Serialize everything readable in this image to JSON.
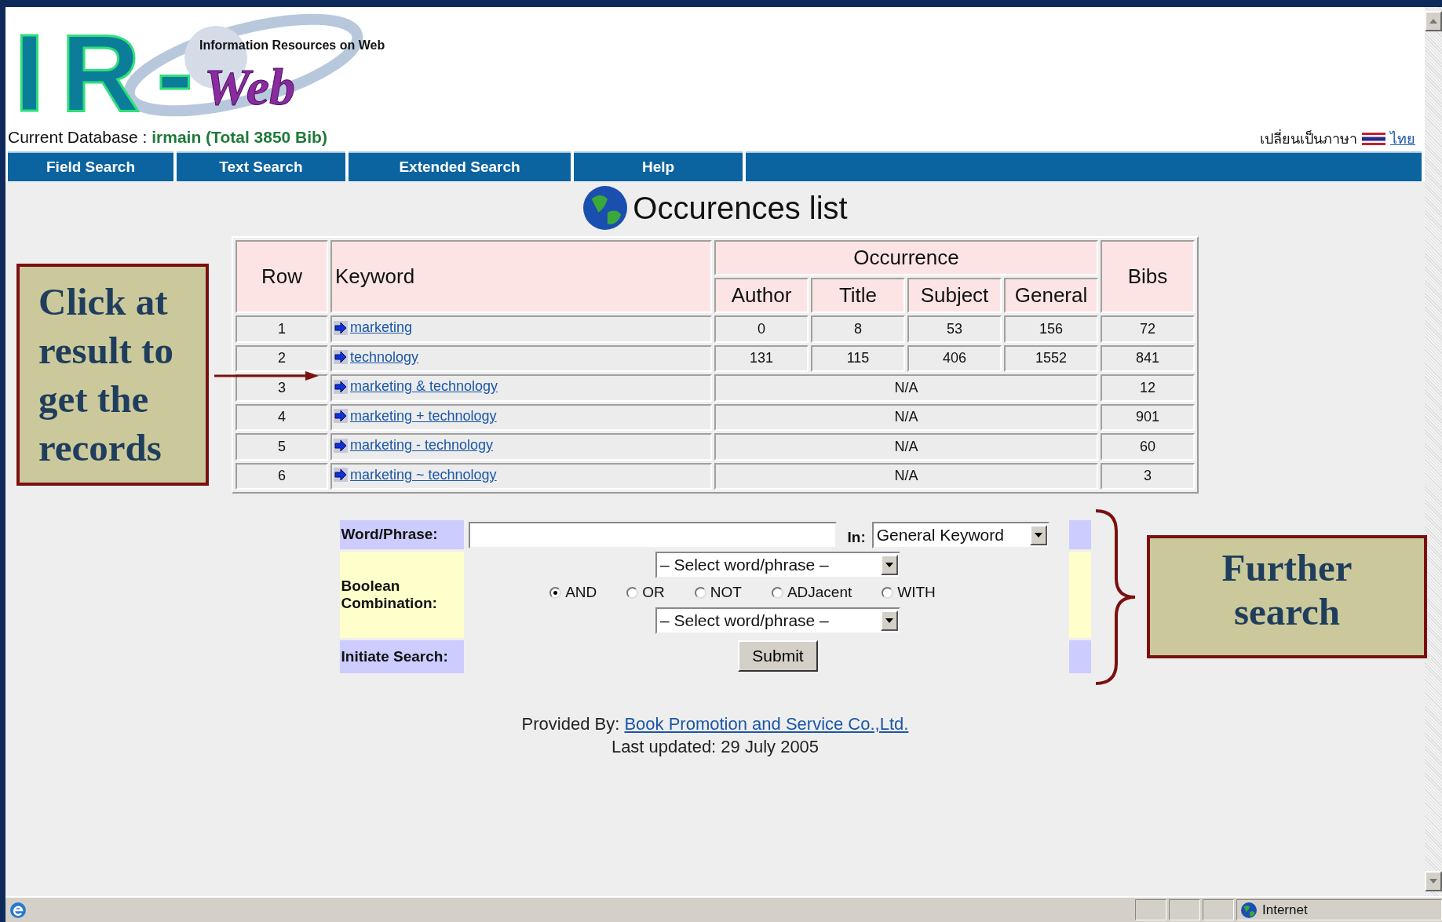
{
  "logo": {
    "mark": "IR-",
    "word": "Web",
    "tagline": "Information Resources on Web"
  },
  "database": {
    "label": "Current Database :",
    "value": "irmain (Total 3850 Bib)"
  },
  "language": {
    "label": "เปลี่ยนเป็นภาษา",
    "link": "ไทย"
  },
  "nav": [
    "Field Search",
    "Text Search",
    "Extended Search",
    "Help"
  ],
  "title": "Occurences list",
  "table": {
    "columns": {
      "row": "Row",
      "keyword": "Keyword",
      "group": "Occurrence",
      "subcolumns": [
        "Author",
        "Title",
        "Subject",
        "General"
      ],
      "bibs": "Bibs"
    },
    "rows": [
      {
        "kind": "counts",
        "row": "1",
        "keyword": "marketing",
        "counts": [
          "0",
          "8",
          "53",
          "156"
        ],
        "bibs": "72"
      },
      {
        "kind": "counts",
        "row": "2",
        "keyword": "technology",
        "counts": [
          "131",
          "115",
          "406",
          "1552"
        ],
        "bibs": "841"
      },
      {
        "kind": "na",
        "row": "3",
        "keyword": "marketing & technology",
        "occurrence": "N/A",
        "bibs": "12"
      },
      {
        "kind": "na",
        "row": "4",
        "keyword": "marketing + technology",
        "occurrence": "N/A",
        "bibs": "901"
      },
      {
        "kind": "na",
        "row": "5",
        "keyword": "marketing - technology",
        "occurrence": "N/A",
        "bibs": "60"
      },
      {
        "kind": "na",
        "row": "6",
        "keyword": "marketing ~ technology",
        "occurrence": "N/A",
        "bibs": "3"
      }
    ]
  },
  "form": {
    "word_label": "Word/Phrase:",
    "in_label": "In:",
    "in_select": "General Keyword",
    "boolean_label": "Boolean Combination:",
    "select_first": "– Select word/phrase –",
    "operators": [
      {
        "label": "AND",
        "selected": true
      },
      {
        "label": "OR",
        "selected": false
      },
      {
        "label": "NOT",
        "selected": false
      },
      {
        "label": "ADJacent",
        "selected": false
      },
      {
        "label": "WITH",
        "selected": false
      }
    ],
    "select_second": "– Select word/phrase –",
    "initiate_label": "Initiate Search:",
    "submit": "Submit"
  },
  "footer": {
    "provided_label": "Provided By:",
    "provider": "Book Promotion and Service Co.,Ltd.",
    "updated": "Last updated: 29 July 2005"
  },
  "status_bar": {
    "zone": "Internet"
  },
  "annotations": [
    {
      "kind": "arrow",
      "text": "Click at result to get the records"
    },
    {
      "kind": "brace",
      "text": "Further search"
    }
  ]
}
